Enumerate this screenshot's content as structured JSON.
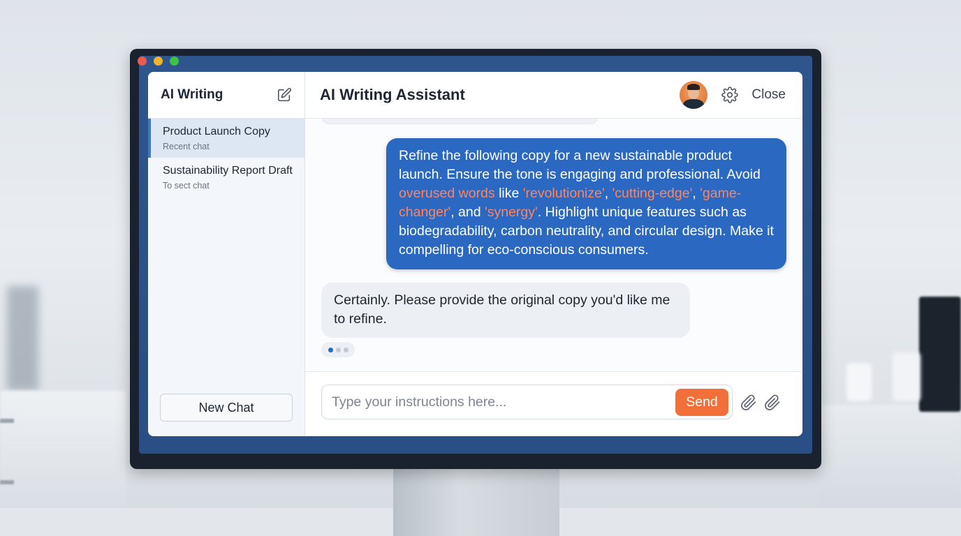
{
  "window_controls": [
    "close",
    "minimize",
    "maximize"
  ],
  "sidebar": {
    "title": "AI Writing",
    "edit_icon": "edit-icon",
    "items": [
      {
        "label": "Product Launch Copy",
        "sub": "Recent chat",
        "active": true
      },
      {
        "label": "Sustainability Report Draft",
        "sub": "To sect chat",
        "active": false
      }
    ],
    "new_chat_label": "New Chat"
  },
  "header": {
    "title": "AI Writing Assistant",
    "avatar_icon": "avatar",
    "settings_icon": "gear-icon",
    "close_label": "Close"
  },
  "messages": {
    "user": {
      "segments": [
        {
          "text": "Refine the following copy for a new sustainable product launch. Ensure the tone is engaging and professional. Avoid ",
          "highlight": false
        },
        {
          "text": "overused words",
          "highlight": true
        },
        {
          "text": " like ",
          "highlight": false
        },
        {
          "text": "'revolutionize'",
          "highlight": true
        },
        {
          "text": ", ",
          "highlight": false
        },
        {
          "text": "'cutting-edge'",
          "highlight": true
        },
        {
          "text": ", ",
          "highlight": false
        },
        {
          "text": "'game-changer'",
          "highlight": true
        },
        {
          "text": ", and ",
          "highlight": false
        },
        {
          "text": "'synergy'",
          "highlight": true
        },
        {
          "text": ". Highlight unique features such as biodegradability, carbon neutrality, and circular design. Make it compelling for eco-conscious consumers.",
          "highlight": false
        }
      ]
    },
    "assistant": {
      "text": "Certainly. Please provide the original copy you'd like me to refine."
    },
    "typing_indicator": "typing-indicator"
  },
  "composer": {
    "placeholder": "Type your instructions here...",
    "value": "",
    "send_label": "Send",
    "attach_icons": [
      "paperclip-icon",
      "paperclip-icon"
    ]
  },
  "colors": {
    "accent": "#2a68c1",
    "highlight": "#ff8560",
    "send": "#f26f3a"
  }
}
